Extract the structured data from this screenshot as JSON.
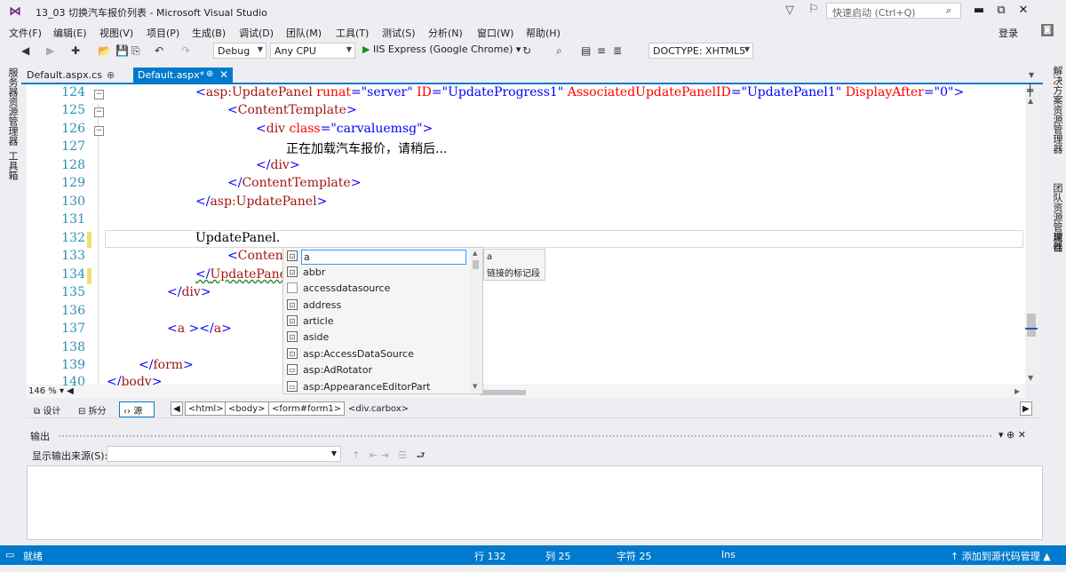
{
  "title": {
    "app_title": "13_03 切换汽车报价列表 - Microsoft Visual Studio",
    "quick_launch_placeholder": "快速启动 (Ctrl+Q)",
    "minimize": "▬",
    "restore": "⧉",
    "close": "✕"
  },
  "menu": {
    "items": [
      "文件(F)",
      "编辑(E)",
      "视图(V)",
      "项目(P)",
      "生成(B)",
      "调试(D)",
      "团队(M)",
      "工具(T)",
      "测试(S)",
      "分析(N)",
      "窗口(W)",
      "帮助(H)"
    ],
    "login": "登录"
  },
  "toolbar": {
    "config": "Debug",
    "platform": "Any CPU",
    "run_target": "IIS Express (Google Chrome)",
    "doctype": "DOCTYPE: XHTML5"
  },
  "left_strip": {
    "server_explorer": "服务器资源管理器",
    "toolbox": "工具箱"
  },
  "right_strip": {
    "solution_explorer": "解决方案资源管理器",
    "team_explorer": "团队资源管理器",
    "properties": "属性"
  },
  "tabs": {
    "cs_tab": "Default.aspx.cs",
    "cs_pin": "⊕",
    "aspx_tab": "Default.aspx*",
    "aspx_pin": "⊕",
    "aspx_close": "✕"
  },
  "editor": {
    "line_numbers": [
      "124",
      "125",
      "126",
      "127",
      "128",
      "129",
      "130",
      "131",
      "132",
      "133",
      "134",
      "135",
      "136",
      "137",
      "138",
      "139",
      "140"
    ],
    "zoom": "146 %"
  },
  "intellisense": {
    "typed": "a",
    "items": [
      "abbr",
      "accessdatasource",
      "address",
      "article",
      "aside",
      "asp:AccessDataSource",
      "asp:AdRotator",
      "asp:AppearanceEditorPart"
    ],
    "tooltip_name": "a",
    "tooltip_desc": "链接的标记段"
  },
  "view_bar": {
    "design": "设计",
    "split": "拆分",
    "source": "源",
    "crumbs": [
      "<html>",
      "<body>",
      "<form#form1>"
    ],
    "current": "<div.carbox>"
  },
  "output": {
    "title": "输出",
    "source_label": "显示输出来源(S):",
    "source_value": ""
  },
  "status": {
    "ready": "就绪",
    "line": "行 132",
    "col": "列 25",
    "char": "字符 25",
    "ins": "Ins",
    "source_control": "↑ 添加到源代码管理 ▲"
  }
}
